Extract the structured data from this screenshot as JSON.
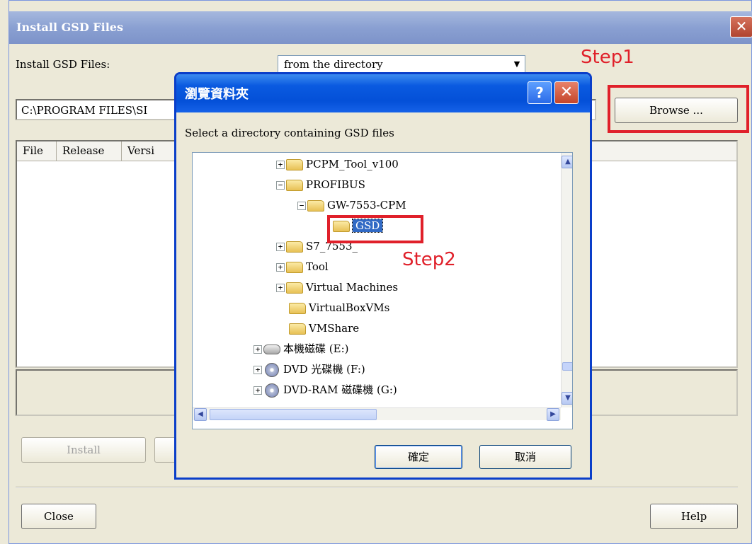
{
  "main_window": {
    "title": "Install GSD Files",
    "install_label": "Install GSD Files:",
    "source_select": "from the directory",
    "path": "C:\\PROGRAM FILES\\SI",
    "columns": [
      "File",
      "Release",
      "Versi"
    ],
    "buttons": {
      "browse": "Browse ...",
      "install": "Install",
      "close": "Close",
      "help": "Help"
    },
    "close_glyph": "✕"
  },
  "annotations": {
    "step1": "Step1",
    "step2": "Step2",
    "color": "#e0202a"
  },
  "browse_dialog": {
    "title": "瀏覽資料夾",
    "instruction": "Select a directory containing GSD files",
    "help_glyph": "?",
    "close_glyph": "✕",
    "tree": [
      {
        "label": "PCPM_Tool_v100",
        "expander": "+",
        "icon": "folder-icon"
      },
      {
        "label": "PROFIBUS",
        "expander": "−",
        "icon": "folder-open-icon"
      },
      {
        "label": "GW-7553-CPM",
        "expander": "−",
        "icon": "folder-open-icon"
      },
      {
        "label": "GSD",
        "expander": "",
        "icon": "folder-open-icon",
        "selected": true
      },
      {
        "label": "S7_7553_",
        "expander": "+",
        "icon": "folder-icon"
      },
      {
        "label": "Tool",
        "expander": "+",
        "icon": "folder-icon"
      },
      {
        "label": "Virtual Machines",
        "expander": "+",
        "icon": "folder-icon"
      },
      {
        "label": "VirtualBoxVMs",
        "expander": "",
        "icon": "folder-icon"
      },
      {
        "label": "VMShare",
        "expander": "",
        "icon": "folder-icon"
      },
      {
        "label": "本機磁碟 (E:)",
        "expander": "+",
        "icon": "hard-drive-icon"
      },
      {
        "label": "DVD 光碟機 (F:)",
        "expander": "+",
        "icon": "dvd-drive-icon"
      },
      {
        "label": "DVD-RAM 磁碟機 (G:)",
        "expander": "+",
        "icon": "dvd-ram-drive-icon"
      }
    ],
    "buttons": {
      "ok": "確定",
      "cancel": "取消"
    },
    "scroll_glyphs": {
      "up": "▲",
      "down": "▼",
      "left": "◀",
      "right": "▶"
    }
  }
}
